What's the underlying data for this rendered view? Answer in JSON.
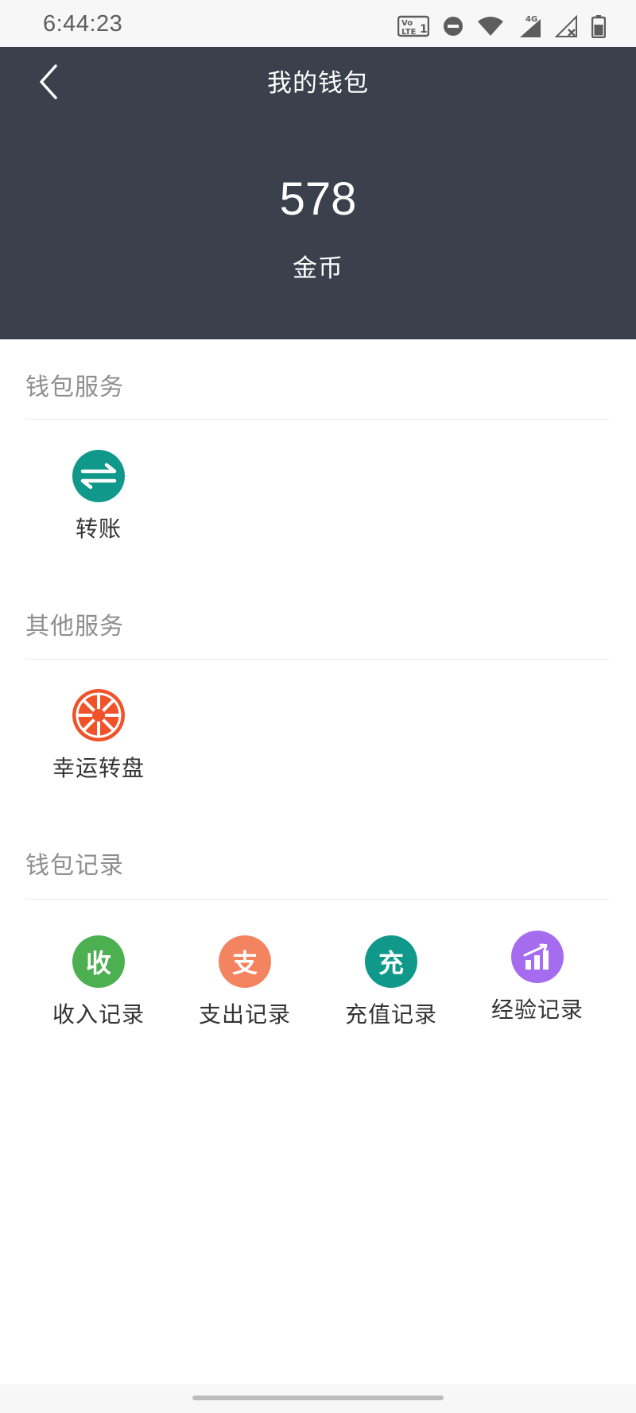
{
  "status_bar": {
    "time": "6:44:23",
    "network_label": "4G",
    "volte_label": "Vo LTE 1",
    "icons": [
      "volte-icon",
      "dnd-icon",
      "wifi-icon",
      "signal-icon",
      "signal-x-icon",
      "battery-icon"
    ]
  },
  "header": {
    "title": "我的钱包",
    "balance": "578",
    "currency_label": "金币",
    "background_color": "#3a404c"
  },
  "sections": {
    "wallet_services": {
      "title": "钱包服务",
      "items": [
        {
          "label": "转账",
          "icon": "transfer-icon",
          "color": "#10998a"
        }
      ]
    },
    "other_services": {
      "title": "其他服务",
      "items": [
        {
          "label": "幸运转盘",
          "icon": "lucky-wheel-icon",
          "color": "#f0532a"
        }
      ]
    },
    "wallet_records": {
      "title": "钱包记录",
      "items": [
        {
          "label": "收入记录",
          "glyph": "收",
          "icon": "income-icon",
          "color": "#4caf50"
        },
        {
          "label": "支出记录",
          "glyph": "支",
          "icon": "expense-icon",
          "color": "#f4845f"
        },
        {
          "label": "充值记录",
          "glyph": "充",
          "icon": "recharge-icon",
          "color": "#10998a"
        },
        {
          "label": "经验记录",
          "icon": "experience-chart-icon",
          "color": "#a66cf0"
        }
      ]
    }
  }
}
